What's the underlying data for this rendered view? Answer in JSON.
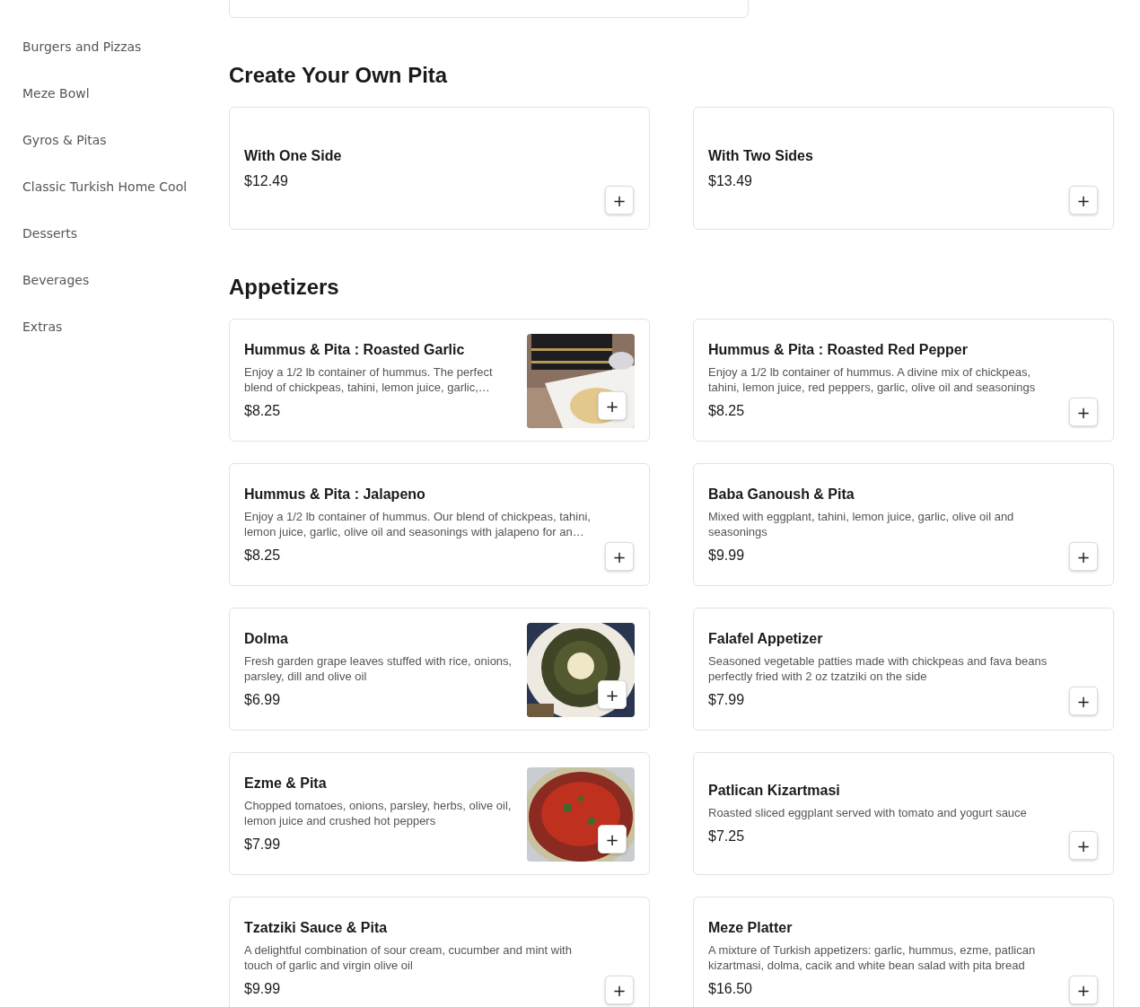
{
  "sidebar": {
    "items": [
      {
        "label": "Burgers and Pizzas"
      },
      {
        "label": "Meze Bowl"
      },
      {
        "label": "Gyros & Pitas"
      },
      {
        "label": "Classic Turkish Home Cool"
      },
      {
        "label": "Desserts"
      },
      {
        "label": "Beverages"
      },
      {
        "label": "Extras"
      }
    ]
  },
  "sections": [
    {
      "items": [
        {
          "kind": "cut"
        }
      ]
    },
    {
      "title": "Create Your Own Pita",
      "items": [
        {
          "kind": "plain",
          "name": "With One Side",
          "price": "$12.49",
          "add": "+"
        },
        {
          "kind": "plain",
          "name": "With Two Sides",
          "price": "$13.49",
          "add": "+"
        }
      ]
    },
    {
      "title": "Appetizers",
      "items": [
        {
          "kind": "picture",
          "name": "Hummus & Pita : Roasted Garlic",
          "description": "Enjoy a 1/2 lb container of hummus. The perfect blend of chickpeas, tahini, lemon juice, garlic,…",
          "price": "$8.25",
          "add": "+"
        },
        {
          "kind": "plain",
          "name": "Hummus & Pita : Roasted Red Pepper",
          "description": "Enjoy a 1/2 lb container of hummus. A divine mix of chickpeas, tahini, lemon juice, red peppers, garlic, olive oil and seasonings",
          "price": "$8.25",
          "add": "+"
        },
        {
          "kind": "plain",
          "name": "Hummus & Pita : Jalapeno",
          "description": "Enjoy a 1/2 lb container of hummus. Our blend of chickpeas, tahini, lemon juice, garlic, olive oil and seasonings with jalapeno for an…",
          "price": "$8.25",
          "add": "+"
        },
        {
          "kind": "plain",
          "name": "Baba Ganoush & Pita",
          "description": "Mixed with eggplant, tahini, lemon juice, garlic, olive oil and seasonings",
          "price": "$9.99",
          "add": "+"
        },
        {
          "kind": "picture",
          "name": "Dolma",
          "description": "Fresh garden grape leaves stuffed with rice, onions, parsley, dill and olive oil",
          "price": "$6.99",
          "add": "+"
        },
        {
          "kind": "plain",
          "name": "Falafel Appetizer",
          "description": "Seasoned vegetable patties made with chickpeas and fava beans perfectly fried with 2 oz tzatziki on the side",
          "price": "$7.99",
          "add": "+"
        },
        {
          "kind": "picture",
          "name": "Ezme & Pita",
          "description": "Chopped tomatoes, onions, parsley, herbs, olive oil, lemon juice and crushed hot peppers",
          "price": "$7.99",
          "add": "+"
        },
        {
          "kind": "plain",
          "name": "Patlican Kizartmasi",
          "description": "Roasted sliced eggplant served with tomato and yogurt sauce",
          "price": "$7.25",
          "add": "+"
        },
        {
          "kind": "plain",
          "name": "Tzatziki Sauce & Pita",
          "description": "A delightful combination of sour cream, cucumber and mint with touch of garlic and virgin olive oil",
          "price": "$9.99",
          "add": "+"
        },
        {
          "kind": "plain",
          "name": "Meze Platter",
          "description": "A mixture of Turkish appetizers: garlic, hummus, ezme, patlican kizartmasi, dolma, cacik and white bean salad with pita bread",
          "price": "$16.50",
          "add": "+"
        }
      ]
    }
  ]
}
